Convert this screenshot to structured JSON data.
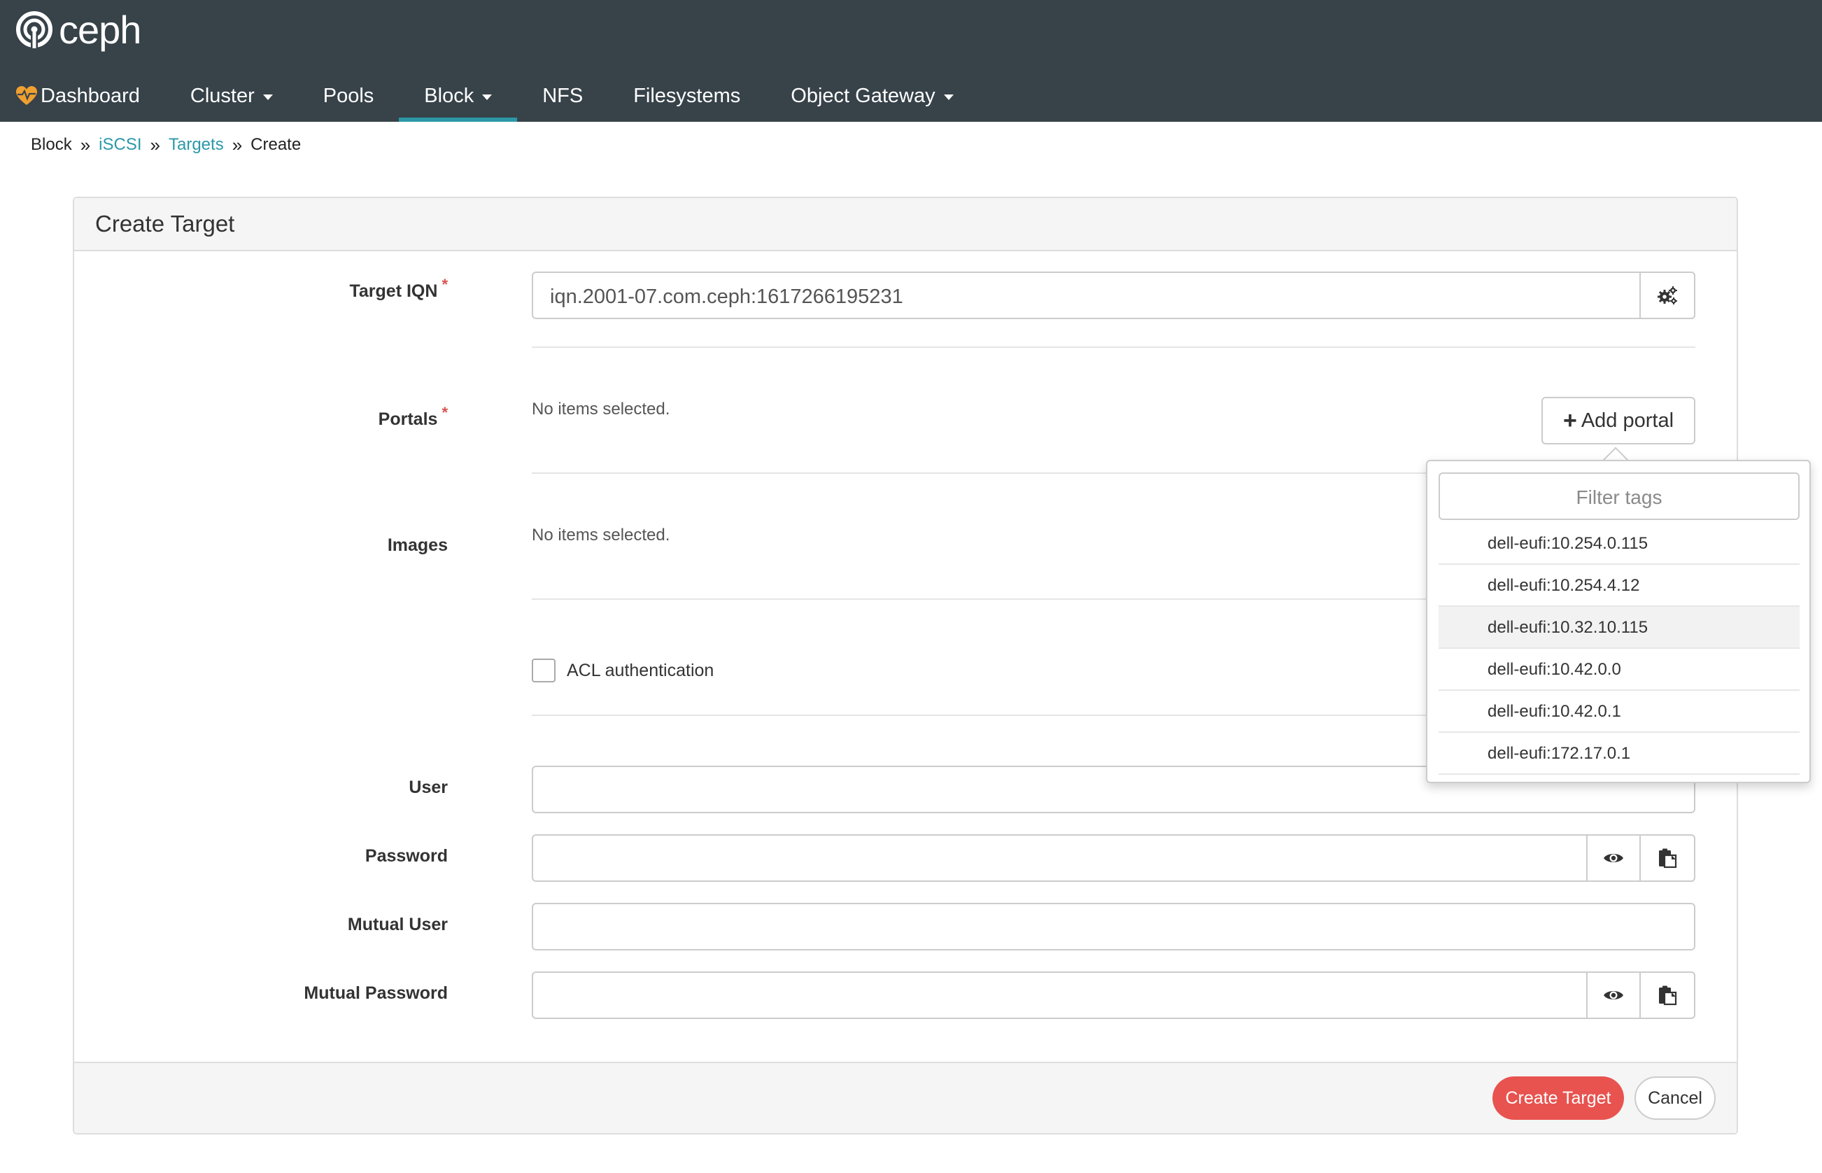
{
  "brand": {
    "name": "ceph"
  },
  "nav": {
    "items": [
      {
        "label": "Dashboard",
        "icon": "heart-pulse-icon",
        "dropdown": false,
        "active": false
      },
      {
        "label": "Cluster",
        "dropdown": true,
        "active": false
      },
      {
        "label": "Pools",
        "dropdown": false,
        "active": false
      },
      {
        "label": "Block",
        "dropdown": true,
        "active": true
      },
      {
        "label": "NFS",
        "dropdown": false,
        "active": false
      },
      {
        "label": "Filesystems",
        "dropdown": false,
        "active": false
      },
      {
        "label": "Object Gateway",
        "dropdown": true,
        "active": false
      }
    ]
  },
  "breadcrumb": {
    "items": [
      "Block",
      "iSCSI",
      "Targets",
      "Create"
    ]
  },
  "form": {
    "title": "Create Target",
    "target_iqn": {
      "label": "Target IQN",
      "value": "iqn.2001-07.com.ceph:1617266195231"
    },
    "portals": {
      "label": "Portals",
      "empty_text": "No items selected.",
      "add_label": "Add portal"
    },
    "images": {
      "label": "Images",
      "empty_text": "No items selected."
    },
    "acl": {
      "label": "ACL authentication",
      "checked": false
    },
    "user": {
      "label": "User",
      "value": ""
    },
    "password": {
      "label": "Password",
      "value": ""
    },
    "mutual_user": {
      "label": "Mutual User",
      "value": ""
    },
    "mutual_password": {
      "label": "Mutual Password",
      "value": ""
    },
    "required_marker": "*"
  },
  "portal_dropdown": {
    "filter_placeholder": "Filter tags",
    "options": [
      "dell-eufi:10.254.0.115",
      "dell-eufi:10.254.4.12",
      "dell-eufi:10.32.10.115",
      "dell-eufi:10.42.0.0",
      "dell-eufi:10.42.0.1",
      "dell-eufi:172.17.0.1"
    ],
    "highlighted_index": 2
  },
  "footer": {
    "submit_label": "Create Target",
    "cancel_label": "Cancel"
  },
  "colors": {
    "topbar": "#374249",
    "accent": "#2b99a8",
    "primary_button": "#e8534f",
    "required": "#d9534f"
  }
}
